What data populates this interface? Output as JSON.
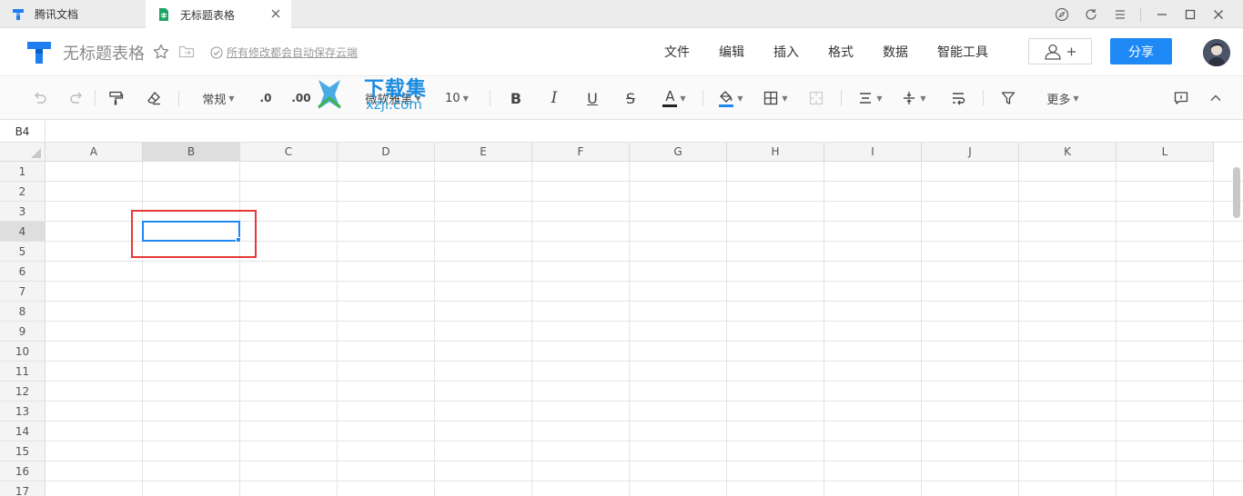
{
  "tabs": [
    {
      "label": "腾讯文档"
    },
    {
      "label": "无标题表格"
    }
  ],
  "header": {
    "doc_title": "无标题表格",
    "save_status": "所有修改都会自动保存云端",
    "menu": [
      "文件",
      "编辑",
      "插入",
      "格式",
      "数据",
      "智能工具"
    ],
    "share_label": "分享"
  },
  "toolbar": {
    "number_format": "常规",
    "decimal_decrease": ".0",
    "decimal_increase": ".00",
    "font_name": "微软雅黑",
    "font_size": "10",
    "bold": "B",
    "italic": "I",
    "underline": "U",
    "strike": "S",
    "font_color_label": "A",
    "more_label": "更多"
  },
  "watermark": {
    "line1": "下载集",
    "line2": "xzji.com"
  },
  "formula_bar": {
    "cell_ref": "B4"
  },
  "sheet": {
    "columns": [
      "A",
      "B",
      "C",
      "D",
      "E",
      "F",
      "G",
      "H",
      "I",
      "J",
      "K",
      "L"
    ],
    "rows": [
      "1",
      "2",
      "3",
      "4",
      "5",
      "6",
      "7",
      "8",
      "9",
      "10",
      "11",
      "12",
      "13",
      "14",
      "15",
      "16",
      "17"
    ],
    "selected_cell": "B4"
  },
  "colors": {
    "accent": "#1e88f5",
    "highlight_box": "#e53935",
    "sheet_tab_icon": "#21a366"
  }
}
